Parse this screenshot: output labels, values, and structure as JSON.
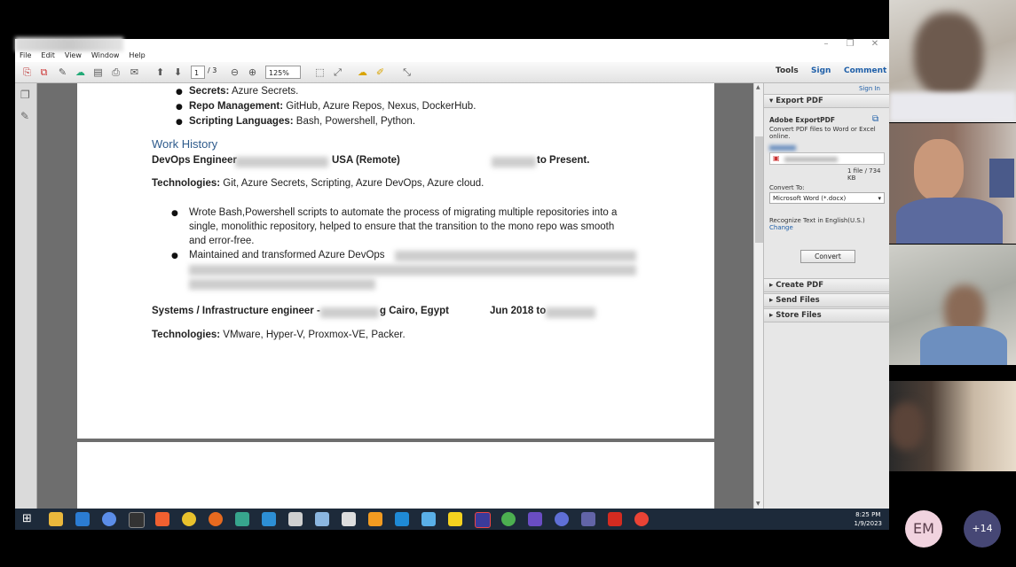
{
  "window": {
    "controls": [
      "–",
      "❐",
      "✕"
    ]
  },
  "menu": [
    "File",
    "Edit",
    "View",
    "Window",
    "Help"
  ],
  "toolbar": {
    "page_current": "1",
    "page_total": "/ 3",
    "zoom": "125%",
    "tools": "Tools",
    "sign": "Sign",
    "comment": "Comment"
  },
  "document": {
    "bullets_top": [
      {
        "bold": "Secrets:",
        "text": " Azure Secrets."
      },
      {
        "bold": "Repo Management:",
        "text": " GitHub, Azure Repos, Nexus, DockerHub."
      },
      {
        "bold": "Scripting Languages:",
        "text": " Bash, Powershell, Python."
      }
    ],
    "section_title": "Work History",
    "job1": {
      "title": "DevOps Engineer",
      "location": "USA (Remote)",
      "dates": "to Present.",
      "tech_label": "Technologies:",
      "tech": " Git, Azure Secrets, Scripting, Azure DevOps, Azure cloud.",
      "bullet1": [
        "Wrote Bash,Powershell scripts to automate the process of migrating multiple repositories into a",
        "single, monolithic repository, helped to ensure that the transition to the mono repo was smooth",
        "and error-free."
      ],
      "bullet2": "Maintained and transformed Azure DevOps"
    },
    "job2": {
      "title": "Systems / Infrastructure engineer -",
      "location": "g Cairo, Egypt",
      "dates": "Jun 2018 to",
      "tech_label": "Technologies:",
      "tech": " VMware, Hyper-V, Proxmox-VE, Packer."
    }
  },
  "right_pane": {
    "sign_in": "Sign In",
    "export_pdf": "Export PDF",
    "adobe_export": "Adobe ExportPDF",
    "desc": [
      "Convert PDF files to Word or Excel",
      "online."
    ],
    "file_info": "1 file / 734 KB",
    "convert_to": "Convert To:",
    "format": "Microsoft Word (*.docx)",
    "recognize": "Recognize Text in English(U.S.)",
    "change": "Change",
    "convert_btn": "Convert",
    "create_pdf": "Create PDF",
    "send_files": "Send Files",
    "store_files": "Store Files"
  },
  "taskbar": {
    "time": "8:25 PM",
    "date": "1/9/2023"
  },
  "participants": {
    "initials": "EM",
    "more": "+14"
  }
}
